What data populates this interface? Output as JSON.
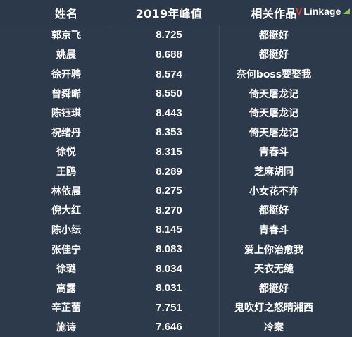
{
  "watermark": {
    "v": "V",
    "rest": "Linkage"
  },
  "header": {
    "name": "姓名",
    "score": "2019年峰值",
    "work": "相关作品"
  },
  "rows": [
    {
      "name": "郭京飞",
      "score": "8.725",
      "work": "都挺好"
    },
    {
      "name": "姚晨",
      "score": "8.688",
      "work": "都挺好"
    },
    {
      "name": "徐开骋",
      "score": "8.574",
      "work": "奈何boss要娶我"
    },
    {
      "name": "曾舜晞",
      "score": "8.550",
      "work": "倚天屠龙记"
    },
    {
      "name": "陈钰琪",
      "score": "8.443",
      "work": "倚天屠龙记"
    },
    {
      "name": "祝绪丹",
      "score": "8.353",
      "work": "倚天屠龙记"
    },
    {
      "name": "徐悦",
      "score": "8.315",
      "work": "青春斗"
    },
    {
      "name": "王鸥",
      "score": "8.289",
      "work": "芝麻胡同"
    },
    {
      "name": "林依晨",
      "score": "8.275",
      "work": "小女花不弃"
    },
    {
      "name": "倪大红",
      "score": "8.270",
      "work": "都挺好"
    },
    {
      "name": "陈小纭",
      "score": "8.145",
      "work": "青春斗"
    },
    {
      "name": "张佳宁",
      "score": "8.083",
      "work": "爱上你治愈我"
    },
    {
      "name": "徐璐",
      "score": "8.034",
      "work": "天衣无缝"
    },
    {
      "name": "高露",
      "score": "8.031",
      "work": "都挺好"
    },
    {
      "name": "辛芷蕾",
      "score": "7.751",
      "work": "鬼吹灯之怒晴湘西"
    },
    {
      "name": "施诗",
      "score": "7.646",
      "work": "冷案"
    }
  ]
}
